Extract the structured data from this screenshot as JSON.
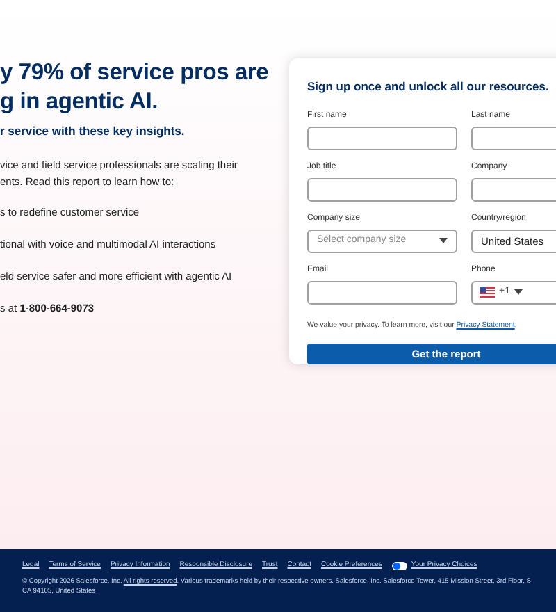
{
  "hero": {
    "heading_lines": [
      "y 79% of service pros are",
      "g in agentic AI."
    ],
    "subheading": "r service with these key insights.",
    "intro_lines": [
      "vice and field service professionals are scaling their",
      "ents. Read this report to learn how to:"
    ],
    "bullets": [
      "s to redefine customer service",
      "tional with voice and multimodal AI interactions",
      "eld service safer and more efficient with agentic AI"
    ],
    "phone": {
      "before": "s at ",
      "number": "1-800-664-9073"
    }
  },
  "form": {
    "title": "Sign up once and unlock all our resources.",
    "fields": [
      {
        "label": "First name",
        "kind": "text"
      },
      {
        "label": "Last name",
        "kind": "text"
      },
      {
        "label": "Job title",
        "kind": "text"
      },
      {
        "label": "Company",
        "kind": "text"
      },
      {
        "label": "Company size",
        "kind": "select",
        "placeholder": "Select company size"
      },
      {
        "label": "Country/region",
        "kind": "select",
        "value": "United States"
      },
      {
        "label": "Email",
        "kind": "text"
      },
      {
        "label": "Phone",
        "kind": "phone",
        "value": "+1"
      }
    ],
    "privacy": {
      "before": "We value your privacy. To learn more, visit our ",
      "link": "Privacy Statement",
      "after": "."
    },
    "submit": "Get the report"
  },
  "footer": {
    "links": [
      "Legal",
      "Terms of Service",
      "Privacy Information",
      "Responsible Disclosure",
      "Trust",
      "Contact",
      "Cookie Preferences"
    ],
    "privacy_choices": "Your Privacy Choices",
    "copyright": {
      "before": "© Copyright 2026 Salesforce, Inc. ",
      "link": "All rights reserved",
      "after": ". Various trademarks held by their respective owners. Salesforce, Inc. Salesforce Tower, 415 Mission Street, 3rd Floor, S",
      "line_2": "CA 94105, United States"
    }
  }
}
